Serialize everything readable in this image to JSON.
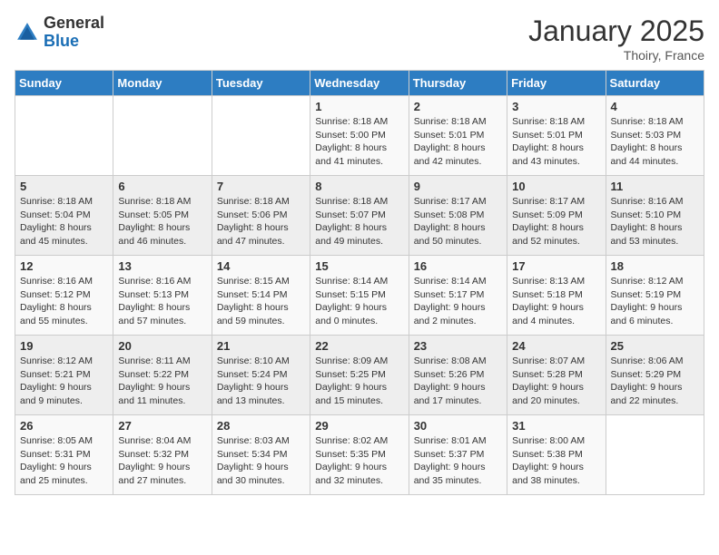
{
  "logo": {
    "general": "General",
    "blue": "Blue"
  },
  "header": {
    "month_year": "January 2025",
    "location": "Thoiry, France"
  },
  "days_of_week": [
    "Sunday",
    "Monday",
    "Tuesday",
    "Wednesday",
    "Thursday",
    "Friday",
    "Saturday"
  ],
  "weeks": [
    [
      {
        "day": "",
        "info": ""
      },
      {
        "day": "",
        "info": ""
      },
      {
        "day": "",
        "info": ""
      },
      {
        "day": "1",
        "info": "Sunrise: 8:18 AM\nSunset: 5:00 PM\nDaylight: 8 hours\nand 41 minutes."
      },
      {
        "day": "2",
        "info": "Sunrise: 8:18 AM\nSunset: 5:01 PM\nDaylight: 8 hours\nand 42 minutes."
      },
      {
        "day": "3",
        "info": "Sunrise: 8:18 AM\nSunset: 5:01 PM\nDaylight: 8 hours\nand 43 minutes."
      },
      {
        "day": "4",
        "info": "Sunrise: 8:18 AM\nSunset: 5:03 PM\nDaylight: 8 hours\nand 44 minutes."
      }
    ],
    [
      {
        "day": "5",
        "info": "Sunrise: 8:18 AM\nSunset: 5:04 PM\nDaylight: 8 hours\nand 45 minutes."
      },
      {
        "day": "6",
        "info": "Sunrise: 8:18 AM\nSunset: 5:05 PM\nDaylight: 8 hours\nand 46 minutes."
      },
      {
        "day": "7",
        "info": "Sunrise: 8:18 AM\nSunset: 5:06 PM\nDaylight: 8 hours\nand 47 minutes."
      },
      {
        "day": "8",
        "info": "Sunrise: 8:18 AM\nSunset: 5:07 PM\nDaylight: 8 hours\nand 49 minutes."
      },
      {
        "day": "9",
        "info": "Sunrise: 8:17 AM\nSunset: 5:08 PM\nDaylight: 8 hours\nand 50 minutes."
      },
      {
        "day": "10",
        "info": "Sunrise: 8:17 AM\nSunset: 5:09 PM\nDaylight: 8 hours\nand 52 minutes."
      },
      {
        "day": "11",
        "info": "Sunrise: 8:16 AM\nSunset: 5:10 PM\nDaylight: 8 hours\nand 53 minutes."
      }
    ],
    [
      {
        "day": "12",
        "info": "Sunrise: 8:16 AM\nSunset: 5:12 PM\nDaylight: 8 hours\nand 55 minutes."
      },
      {
        "day": "13",
        "info": "Sunrise: 8:16 AM\nSunset: 5:13 PM\nDaylight: 8 hours\nand 57 minutes."
      },
      {
        "day": "14",
        "info": "Sunrise: 8:15 AM\nSunset: 5:14 PM\nDaylight: 8 hours\nand 59 minutes."
      },
      {
        "day": "15",
        "info": "Sunrise: 8:14 AM\nSunset: 5:15 PM\nDaylight: 9 hours\nand 0 minutes."
      },
      {
        "day": "16",
        "info": "Sunrise: 8:14 AM\nSunset: 5:17 PM\nDaylight: 9 hours\nand 2 minutes."
      },
      {
        "day": "17",
        "info": "Sunrise: 8:13 AM\nSunset: 5:18 PM\nDaylight: 9 hours\nand 4 minutes."
      },
      {
        "day": "18",
        "info": "Sunrise: 8:12 AM\nSunset: 5:19 PM\nDaylight: 9 hours\nand 6 minutes."
      }
    ],
    [
      {
        "day": "19",
        "info": "Sunrise: 8:12 AM\nSunset: 5:21 PM\nDaylight: 9 hours\nand 9 minutes."
      },
      {
        "day": "20",
        "info": "Sunrise: 8:11 AM\nSunset: 5:22 PM\nDaylight: 9 hours\nand 11 minutes."
      },
      {
        "day": "21",
        "info": "Sunrise: 8:10 AM\nSunset: 5:24 PM\nDaylight: 9 hours\nand 13 minutes."
      },
      {
        "day": "22",
        "info": "Sunrise: 8:09 AM\nSunset: 5:25 PM\nDaylight: 9 hours\nand 15 minutes."
      },
      {
        "day": "23",
        "info": "Sunrise: 8:08 AM\nSunset: 5:26 PM\nDaylight: 9 hours\nand 17 minutes."
      },
      {
        "day": "24",
        "info": "Sunrise: 8:07 AM\nSunset: 5:28 PM\nDaylight: 9 hours\nand 20 minutes."
      },
      {
        "day": "25",
        "info": "Sunrise: 8:06 AM\nSunset: 5:29 PM\nDaylight: 9 hours\nand 22 minutes."
      }
    ],
    [
      {
        "day": "26",
        "info": "Sunrise: 8:05 AM\nSunset: 5:31 PM\nDaylight: 9 hours\nand 25 minutes."
      },
      {
        "day": "27",
        "info": "Sunrise: 8:04 AM\nSunset: 5:32 PM\nDaylight: 9 hours\nand 27 minutes."
      },
      {
        "day": "28",
        "info": "Sunrise: 8:03 AM\nSunset: 5:34 PM\nDaylight: 9 hours\nand 30 minutes."
      },
      {
        "day": "29",
        "info": "Sunrise: 8:02 AM\nSunset: 5:35 PM\nDaylight: 9 hours\nand 32 minutes."
      },
      {
        "day": "30",
        "info": "Sunrise: 8:01 AM\nSunset: 5:37 PM\nDaylight: 9 hours\nand 35 minutes."
      },
      {
        "day": "31",
        "info": "Sunrise: 8:00 AM\nSunset: 5:38 PM\nDaylight: 9 hours\nand 38 minutes."
      },
      {
        "day": "",
        "info": ""
      }
    ]
  ]
}
